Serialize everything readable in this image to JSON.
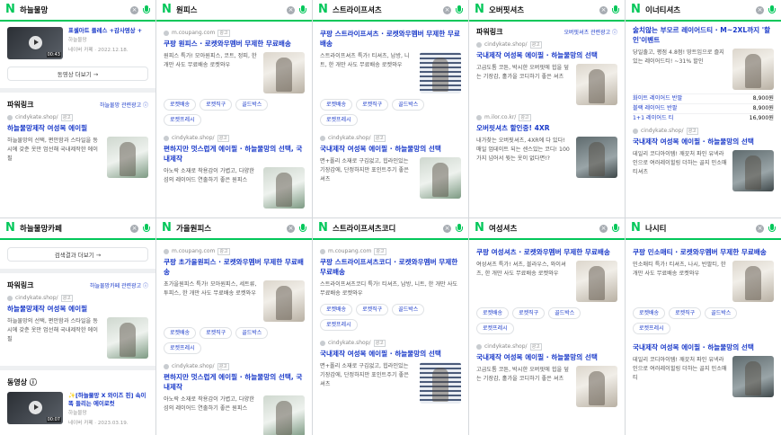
{
  "colors": {
    "brand": "#03c75a",
    "link": "#1a3ac9"
  },
  "icons": {
    "logo": "naver-n-icon",
    "clear": "close-icon",
    "mic": "mic-icon",
    "play": "play-icon",
    "arrow": "arrow-right-icon"
  },
  "panels": [
    {
      "query": "하늘물망",
      "video": {
        "title": "표셀아트 플레스 +감사영상 +",
        "channel": "하늘물망",
        "meta": "네이버 카페 · 2022.12.18.",
        "duration": "00:43"
      },
      "more_label": "동영상 더보기 →",
      "powerlink": {
        "title": "파워링크",
        "link": "하늘물망 관련광고 ⓘ"
      },
      "ad": {
        "source": "cindykate.shop/",
        "badge": "광고",
        "title": "하늘물망제작 여성복 에이필",
        "desc": "하늘물망의 선택, 편안함과 스타일을 동시에 갖춘 옷만 엄선해 국내제작한 에이필"
      }
    },
    {
      "query": "원피스",
      "ads": [
        {
          "source": "m.coupang.com",
          "badge": "광고",
          "title": "쿠팡 원피스 · 로켓와우멤버 무제한 무료배송",
          "desc": "원피스 특가! 모아원피스, 코트, 정피, 한 개만 사도 무료배송 로켓와우",
          "chips": [
            "로켓배송",
            "로켓직구",
            "골드박스",
            "로켓프레시"
          ]
        },
        {
          "source": "cindykate.shop/",
          "badge": "광고",
          "title": "편하지만 멋스럽게 에이필 · 하늘물망의 선택, 국내제작",
          "desc": "아노락 소재로 착용감이 가볍고, 다양한 섬의 레이어드 연출하기 좋은 원피스"
        }
      ]
    },
    {
      "query": "스트라이프셔츠",
      "ads": [
        {
          "source": "",
          "badge": "",
          "title": "쿠팡 스트라이프셔츠 · 로켓와우멤버 무제한 무료배송",
          "desc": "스트라이프셔츠 특가! 티셔츠, 남방, 니트, 한 개만 사도 무료배송 로켓와우",
          "chips": [
            "로켓배송",
            "로켓직구",
            "골드박스",
            "로켓프레시"
          ]
        },
        {
          "source": "cindykate.shop/",
          "badge": "광고",
          "title": "국내제작 여성복 에이필 · 하늘물망의 선택",
          "desc": "면+폴리 소재로 구김없고, 힙라인있는 기장감에, 단정하지만 포인트주기 좋은 셔츠"
        }
      ]
    },
    {
      "query": "오버핏셔츠",
      "powerlink": {
        "title": "파워링크",
        "link": "오버핏셔츠 관련광고 ⓘ"
      },
      "ads": [
        {
          "source": "cindykate.shop/",
          "badge": "광고",
          "title": "국내제작 여성복 에이필 · 하늘물망의 선택",
          "desc": "고급도톰 코튼, 박시한 오버핏에 힙을 덮는 기장감, 홀가을 코디하기 좋은 셔츠"
        },
        {
          "source": "m.ilor.co.kr/",
          "badge": "광고",
          "title": "오버핏셔츠 할인중! 4XR",
          "desc": "내가찾는 오버핏셔츠, 4XR에 다 있다! 매일 업데이트 되는 센스있는 코디! 100가지 넘어서 뭣는 옷이 없다면!?"
        }
      ]
    },
    {
      "query": "이너티셔츠",
      "hero": {
        "title": "술치않는 부모르 레이어드티 · M~2XL까지 '할인'이벤트",
        "desc": "당일출고, 평점 4.8점! 땅트임으로 즐지있는 레이어드티! ~31% 할인"
      },
      "prices": [
        {
          "label": "화이트 레이어드 반팔",
          "value": "8,900원"
        },
        {
          "label": "블랙 레이어드 반팔",
          "value": "8,900원"
        },
        {
          "label": "1+1 레이어드 티",
          "value": "16,900원"
        }
      ],
      "ad": {
        "source": "cindykate.shop/",
        "badge": "광고",
        "title": "국내제작 여성복 에이필 · 하늘물망의 선택",
        "desc": "데일리 코디아이템! 깨끗처 파인 유넥라인으로 여러레이힐링 더하는 골지 민소매티셔츠"
      }
    },
    {
      "query": "하늘물망카페",
      "more_label": "검색결과 더보기 →",
      "powerlink": {
        "title": "파워링크",
        "link": "하늘물망카페 관련광고 ⓘ"
      },
      "ad": {
        "source": "cindykate.shop/",
        "badge": "광고",
        "title": "하늘물망제작 여성복 에이필",
        "desc": "하늘물망의 선택, 편안함과 스타일을 동시에 갖춘 옷만 엄선해 국내제작한 에이필"
      },
      "video_section": "동영상 ⓘ",
      "video": {
        "title": "✨[하늘물망 X 와이즈 핀] 속이 똑 들리는 에이로컷",
        "channel": "하늘물망",
        "meta": "네이버 카페 · 2023.03.19.",
        "duration": "00:07"
      }
    },
    {
      "query": "가을원피스",
      "ads": [
        {
          "source": "m.coupang.com",
          "badge": "광고",
          "title": "쿠팡 초가을원피스 · 로켓와우멤버 무제한 무료배송",
          "desc": "초가을원피스 특가! 모아원피스, 세트류, 투피스, 한 개만 사도 무료배송 로켓와우",
          "chips": [
            "로켓배송",
            "로켓직구",
            "골드박스",
            "로켓프레시"
          ]
        },
        {
          "source": "cindykate.shop/",
          "badge": "광고",
          "title": "편하지만 멋스럽게 에이필 · 하늘물망의 선택, 국내제작",
          "desc": "아노락 소재로 착용감이 가볍고, 다양한 섬의 레이어드 연출하기 좋은 원피스"
        }
      ]
    },
    {
      "query": "스트라이프셔츠코디",
      "ads": [
        {
          "source": "m.coupang.com",
          "badge": "광고",
          "title": "쿠팡 스트라이프셔츠코디 · 로켓와우멤버 무제한 무료배송",
          "desc": "스트라이프셔츠코디 특가! 티셔츠, 남방, 니트, 한 개만 사도 무료배송 로켓와우",
          "chips": [
            "로켓배송",
            "로켓직구",
            "골드박스",
            "로켓프레시"
          ]
        },
        {
          "source": "cindykate.shop/",
          "badge": "광고",
          "title": "국내제작 여성복 에이필 · 하늘물망의 선택",
          "desc": "면+폴리 소재로 구김없고, 힙라인있는 기장감에, 단정하지만 포인트주기 좋은 셔츠"
        }
      ]
    },
    {
      "query": "여성셔츠",
      "ads": [
        {
          "source": "",
          "badge": "",
          "title": "쿠팡 여성셔츠 · 로켓와우멤버 무제한 무료배송",
          "desc": "여성셔츠 특가! 셔츠, 블라우스, 와이셔츠, 한 개만 사도 무료배송 로켓와우",
          "chips": [
            "로켓배송",
            "로켓직구",
            "골드박스",
            "로켓프레시"
          ]
        },
        {
          "source": "cindykate.shop/",
          "badge": "광고",
          "title": "국내제작 여성복 에이필 · 하늘물망의 선택",
          "desc": "고급도톰 코튼, 박시한 오버핏에 힙을 덮는 기장감, 홀가을 코디하기 좋은 셔츠"
        }
      ]
    },
    {
      "query": "나시티",
      "ads": [
        {
          "source": "",
          "badge": "",
          "title": "쿠팡 민소매티 · 로켓와우멤버 무제한 무료배송",
          "desc": "민소매티 특가! 티셔츠, 나시, 반팔티, 한 개만 사도 무료배송 로켓와우",
          "chips": [
            "로켓배송",
            "로켓직구",
            "골드박스",
            "로켓프레시"
          ]
        },
        {
          "source": "",
          "badge": "",
          "title": "국내제작 여성복 에이필 · 하늘물망의 선택",
          "desc": "데일리 코디아이템! 깨끗처 파인 유넥라인으로 여러레이힐링 더하는 골지 민소매티"
        }
      ]
    }
  ]
}
